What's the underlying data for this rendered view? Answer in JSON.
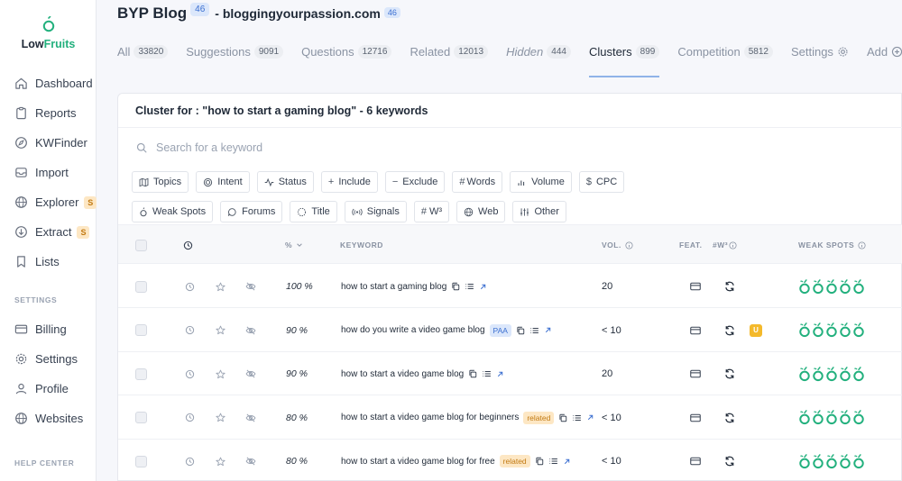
{
  "brand": {
    "low": "Low",
    "fruits": "Fruits"
  },
  "sidebar": {
    "items": [
      {
        "label": "Dashboard",
        "icon": "home-icon"
      },
      {
        "label": "Reports",
        "icon": "clipboard-icon"
      },
      {
        "label": "KWFinder",
        "icon": "compass-icon"
      },
      {
        "label": "Import",
        "icon": "inbox-icon"
      },
      {
        "label": "Explorer",
        "icon": "globe-icon",
        "badge": "S"
      },
      {
        "label": "Extract",
        "icon": "download-circle-icon",
        "badge": "S"
      },
      {
        "label": "Lists",
        "icon": "bookmark-icon"
      }
    ],
    "settings_label": "SETTINGS",
    "settings_items": [
      {
        "label": "Billing",
        "icon": "credit-card-icon"
      },
      {
        "label": "Settings",
        "icon": "gear-icon"
      },
      {
        "label": "Profile",
        "icon": "user-icon"
      },
      {
        "label": "Websites",
        "icon": "globe-icon"
      }
    ],
    "help_label": "HELP CENTER"
  },
  "header": {
    "title": "BYP Blog",
    "title_count": "46",
    "domain": "- bloggingyourpassion.com",
    "domain_count": "46"
  },
  "tabs": [
    {
      "label": "All",
      "count": "33820"
    },
    {
      "label": "Suggestions",
      "count": "9091"
    },
    {
      "label": "Questions",
      "count": "12716"
    },
    {
      "label": "Related",
      "count": "12013"
    },
    {
      "label": "Hidden",
      "count": "444"
    },
    {
      "label": "Clusters",
      "count": "899",
      "active": true
    },
    {
      "label": "Competition",
      "count": "5812"
    },
    {
      "label": "Settings"
    },
    {
      "label": "Add"
    }
  ],
  "cluster_title": "Cluster for : \"how to start a gaming blog\" - 6 keywords",
  "search": {
    "placeholder": "Search for a keyword",
    "value": ""
  },
  "filters": {
    "row1": [
      {
        "label": "Topics",
        "icon": "map-icon"
      },
      {
        "label": "Intent",
        "icon": "target-icon"
      },
      {
        "label": "Status",
        "icon": "pulse-icon"
      },
      {
        "label": "Include",
        "icon": "plus-icon"
      },
      {
        "label": "Exclude",
        "icon": "minus-icon"
      },
      {
        "label": "Words",
        "icon": "hash-icon"
      },
      {
        "label": "Volume",
        "icon": "bars-icon"
      },
      {
        "label": "CPC",
        "icon": "dollar-icon"
      }
    ],
    "row2": [
      {
        "label": "Weak Spots",
        "icon": "apple-icon"
      },
      {
        "label": "Forums",
        "icon": "chat-icon"
      },
      {
        "label": "Title",
        "icon": "dashed-circle-icon"
      },
      {
        "label": "Signals",
        "icon": "signal-icon"
      },
      {
        "label": "W³",
        "icon": "hash-icon"
      },
      {
        "label": "Web",
        "icon": "globe-icon"
      },
      {
        "label": "Other",
        "icon": "sliders-icon"
      }
    ]
  },
  "table": {
    "headers": {
      "pct": "%",
      "keyword": "KEYWORD",
      "vol": "VOL.",
      "feat": "FEAT.",
      "w3": "#W³",
      "weak": "WEAK SPOTS"
    },
    "rows": [
      {
        "pct": "100 %",
        "keyword": "how to start a gaming blog",
        "tag": "",
        "vol": "20",
        "badge": ""
      },
      {
        "pct": "90 %",
        "keyword": "how do you write a video game blog",
        "tag": "PAA",
        "tag_type": "paa",
        "vol": "< 10",
        "badge": "U"
      },
      {
        "pct": "90 %",
        "keyword": "how to start a video game blog",
        "tag": "",
        "vol": "20",
        "badge": ""
      },
      {
        "pct": "80 %",
        "keyword": "how to start a video game blog for beginners",
        "tag": "related",
        "tag_type": "related",
        "vol": "< 10",
        "badge": ""
      },
      {
        "pct": "80 %",
        "keyword": "how to start a video game blog for free",
        "tag": "related",
        "tag_type": "related",
        "vol": "< 10",
        "badge": ""
      }
    ]
  },
  "colors": {
    "accent": "#22b07d",
    "badge_blue": "#3b6fd0",
    "badge_orange": "#c27a12",
    "badge_u": "#f4b92b"
  }
}
